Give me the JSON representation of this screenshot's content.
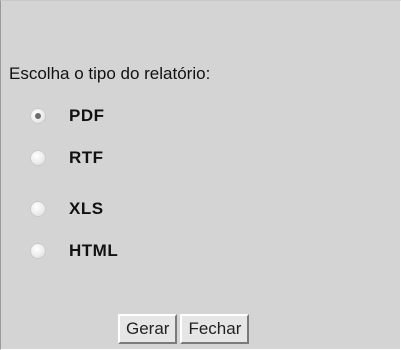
{
  "prompt": "Escolha o tipo do relatório:",
  "options": [
    {
      "label": "PDF",
      "checked": true
    },
    {
      "label": "RTF",
      "checked": false
    },
    {
      "label": "XLS",
      "checked": false
    },
    {
      "label": "HTML",
      "checked": false
    }
  ],
  "buttons": {
    "generate": "Gerar",
    "close": "Fechar"
  }
}
